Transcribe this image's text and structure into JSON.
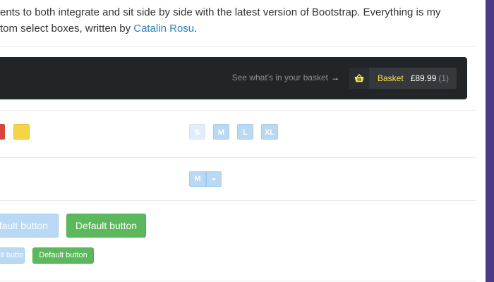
{
  "intro": {
    "line1": "ents to both integrate and sit side by side with the latest version of Bootstrap. Everything is my",
    "line2_prefix": "tom select boxes, written by ",
    "author_link": "Catalin Rosu",
    "line2_suffix": "."
  },
  "navbar": {
    "hint": "See what's in your basket",
    "hint_arrow": "→",
    "basket_label": "Basket",
    "basket_price": "£89.99",
    "basket_count": "(1)",
    "basket_icon": "basket-icon"
  },
  "swatches": [
    {
      "name": "red",
      "color": "#d9443b"
    },
    {
      "name": "yellow",
      "color": "#f5d547"
    }
  ],
  "sizes": [
    "S",
    "M",
    "L",
    "XL"
  ],
  "split_select": {
    "value": "M",
    "caret_icon": "caret-down-icon"
  },
  "buttons": {
    "large_blue": "Default button",
    "large_green": "Default button",
    "small_blue": "Default button",
    "small_green": "Default button"
  },
  "colors": {
    "navbar_bg": "#222527",
    "accent_yellow": "#f5e84a",
    "link": "#2a7fbf",
    "light_blue": "#b8d8f4",
    "green": "#5cb85c",
    "purple_edge": "#4b3b86"
  }
}
